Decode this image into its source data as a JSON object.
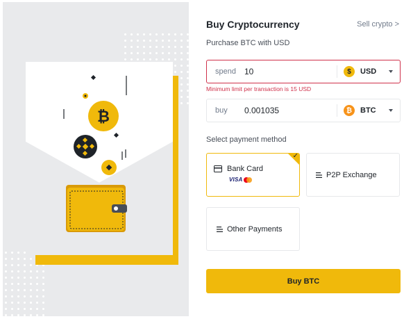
{
  "header": {
    "title": "Buy Cryptocurrency",
    "sell_link": "Sell crypto >",
    "subtitle": "Purchase BTC with USD"
  },
  "spend": {
    "label": "spend",
    "value": "10",
    "currency": "USD",
    "coin_symbol": "$",
    "error": "Minimum limit per transaction is 15 USD"
  },
  "buy": {
    "label": "buy",
    "value": "0.001035",
    "currency": "BTC",
    "coin_symbol": "₿"
  },
  "payment": {
    "label": "Select payment method",
    "options": [
      {
        "label": "Bank Card",
        "brand_text": "VISA",
        "selected": true,
        "icon": "card-icon"
      },
      {
        "label": "P2P Exchange",
        "selected": false,
        "icon": "list-icon"
      },
      {
        "label": "Other Payments",
        "selected": false,
        "icon": "list-icon"
      }
    ]
  },
  "actions": {
    "buy_button": "Buy BTC"
  },
  "illustration": {
    "coin_symbol": "₿",
    "icons": [
      "bitcoin-coin-icon",
      "bnb-coin-icon",
      "wallet-icon"
    ]
  },
  "colors": {
    "accent": "#f0b90b",
    "error": "#cf304a",
    "text_primary": "#1e2329",
    "text_secondary": "#707a8a",
    "panel_bg": "#e9eaec"
  }
}
